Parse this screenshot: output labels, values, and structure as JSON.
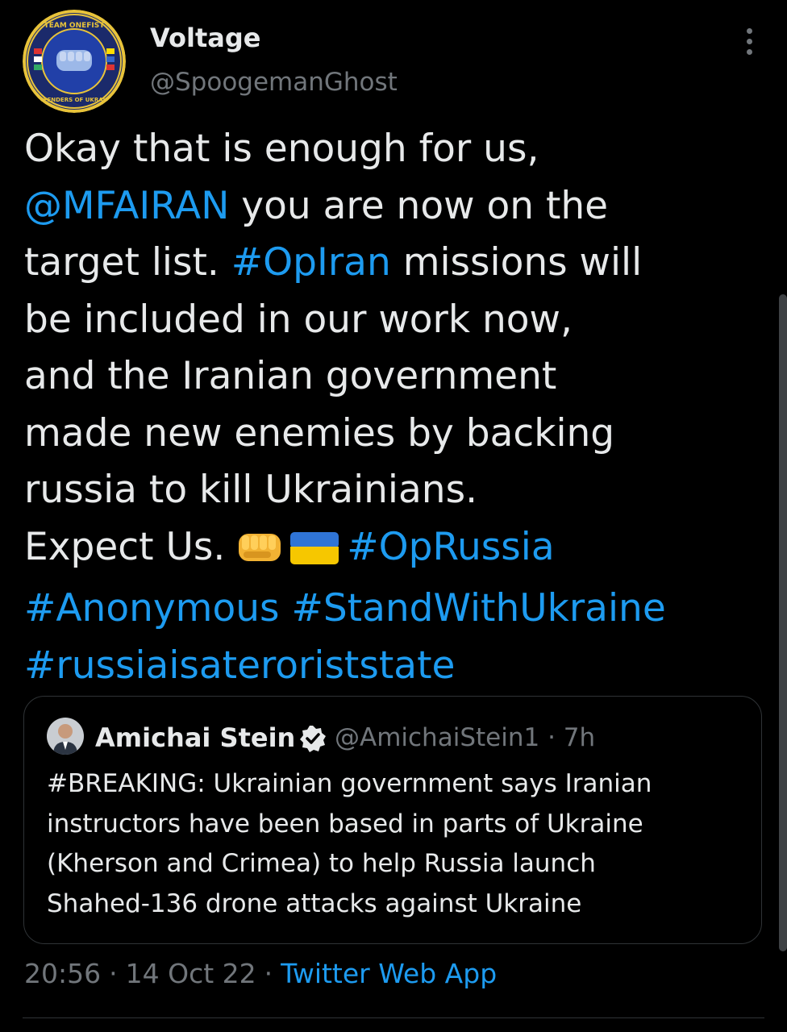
{
  "author": {
    "name": "Voltage",
    "handle": "@SpoogemanGhost",
    "avatar_icon": "team-onefist-defenders-of-ukraine-logo"
  },
  "tweet": {
    "line1": "Okay that is enough for us,",
    "mention": "@MFAIRAN",
    "line2_rest": " you are now on the",
    "line3_start": "target list. ",
    "hashtag_opiran": "#OpIran",
    "line3_rest": " missions will",
    "line4": "be included in our work now,",
    "line5": "and the Iranian government",
    "line6": "made new enemies by backing",
    "line7": "russia to kill Ukrainians.",
    "line8_start": "Expect Us. ",
    "emojis": [
      "fist-emoji",
      "ukraine-flag-emoji"
    ],
    "hashtag_oprussia": "#OpRussia",
    "hashtag_anonymous": "#Anonymous",
    "hashtag_standwithukraine": "#StandWithUkraine",
    "hashtag_terroriststate": "#russiaisateroriststate"
  },
  "quoted_tweet": {
    "name": "Amichai Stein",
    "verified_icon": "verified-badge-icon",
    "handle": "@AmichaiStein1",
    "separator": "·",
    "time": "7h",
    "line1": "#BREAKING: Ukrainian government says Iranian",
    "line2": "instructors have been based in parts of Ukraine",
    "line3": "(Kherson and Crimea) to help Russia launch",
    "line4": "Shahed-136 drone attacks against Ukraine"
  },
  "footer": {
    "time": "20:56",
    "separator": "·",
    "date": "14 Oct 22",
    "source": "Twitter Web App"
  },
  "colors": {
    "background": "#000000",
    "text_primary": "#e7e9ea",
    "text_secondary": "#71767b",
    "link": "#1d9bf0",
    "border": "#2f3336"
  }
}
